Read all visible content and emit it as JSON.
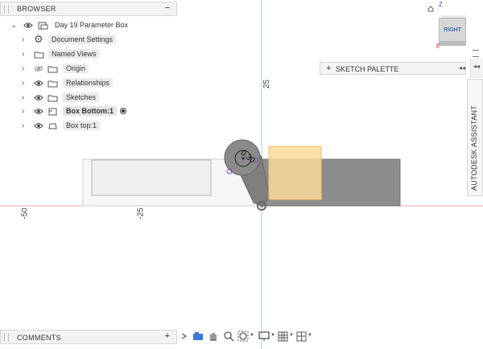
{
  "browser": {
    "title": "BROWSER",
    "collapse_symbol": "−",
    "items": [
      {
        "label": "Day 19 Parameter Box",
        "icon": "document-icon",
        "eye": true
      },
      {
        "label": "Document Settings",
        "icon": "gear-icon",
        "eye": false
      },
      {
        "label": "Named Views",
        "icon": "folder-icon",
        "eye": false
      },
      {
        "label": "Origin",
        "icon": "folder-icon",
        "eye": "hidden"
      },
      {
        "label": "Relationships",
        "icon": "folder-icon",
        "eye": true
      },
      {
        "label": "Sketches",
        "icon": "folder-icon",
        "eye": true
      },
      {
        "label": "Box Bottom:1",
        "icon": "component-icon",
        "eye": true,
        "active": true
      },
      {
        "label": "Box top:1",
        "icon": "body-icon",
        "eye": true
      }
    ]
  },
  "viewcube": {
    "face": "RIGHT",
    "z_axis": "Z",
    "x_axis": "X"
  },
  "sketch_palette": {
    "title": "SKETCH PALETTE",
    "expand_symbol": "+",
    "arrows": "◂◂"
  },
  "assistant": {
    "label": "AUTODESK ASSISTANT",
    "arrows": "◂◂"
  },
  "rulers": {
    "v25": "25",
    "h_neg50": "-50",
    "h_neg25": "-25"
  },
  "sketch": {
    "dimension_text": "0.30",
    "colors": {
      "body": "#8d8d8d",
      "highlight": "#f9d99a",
      "outline": "#cfcfcf",
      "x_axis_line": "#f2a5a5",
      "y_axis_line": "#9fd8d2"
    }
  },
  "comments": {
    "title": "COMMENTS",
    "add_symbol": "+"
  },
  "toolbar": {
    "icons": [
      "orbit-icon",
      "look-at-icon",
      "pan-icon",
      "zoom-icon",
      "fit-icon",
      "display-settings-icon",
      "grid-icon",
      "viewports-icon"
    ]
  }
}
